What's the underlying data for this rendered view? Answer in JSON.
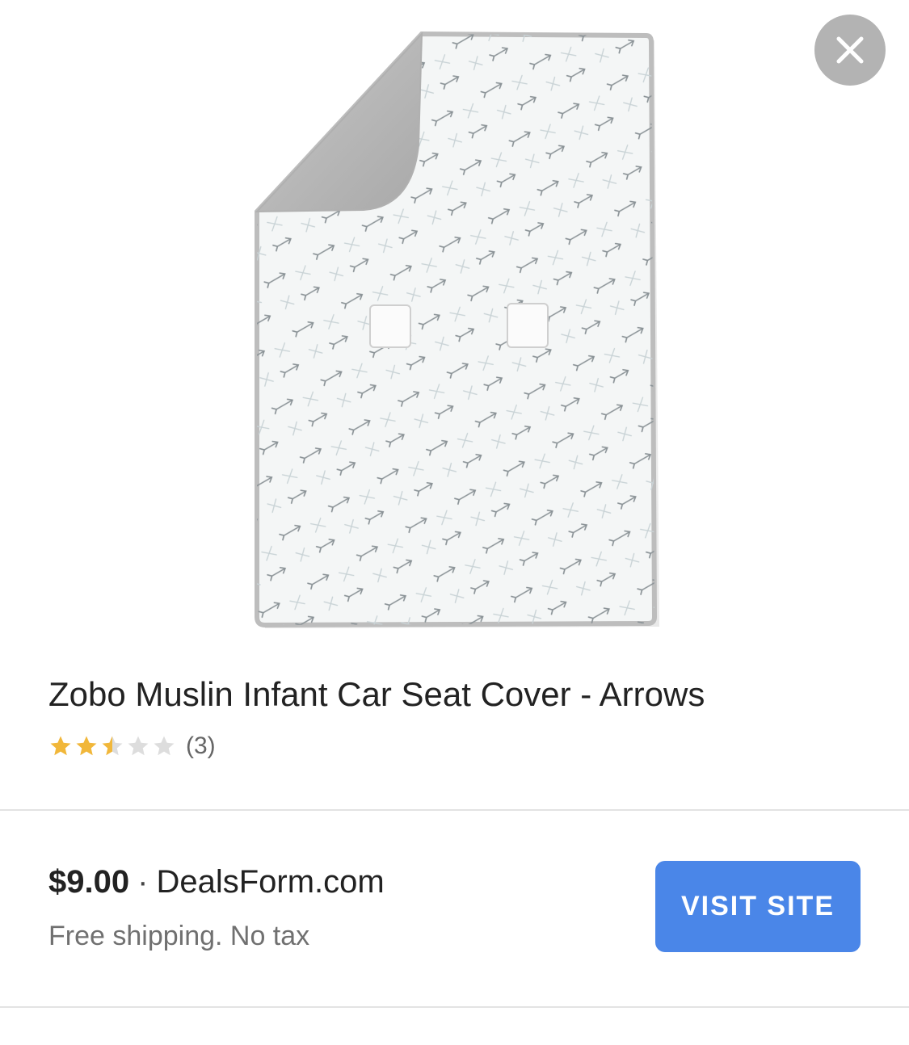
{
  "product": {
    "title": "Zobo Muslin Infant Car Seat Cover - Arrows",
    "image_name": "car-seat-cover-arrows-image",
    "rating": 2.5,
    "rating_max": 5,
    "review_count": "(3)",
    "star_color": "#f1b73a",
    "star_empty_color": "#dddddd"
  },
  "offer": {
    "price": "$9.00",
    "separator": "·",
    "seller": "DealsForm.com",
    "shipping": "Free shipping. No tax",
    "cta_label": "VISIT SITE",
    "cta_color": "#4a86e8"
  },
  "controls": {
    "close_icon": "close-icon",
    "close_bg": "#b3b3b3"
  }
}
